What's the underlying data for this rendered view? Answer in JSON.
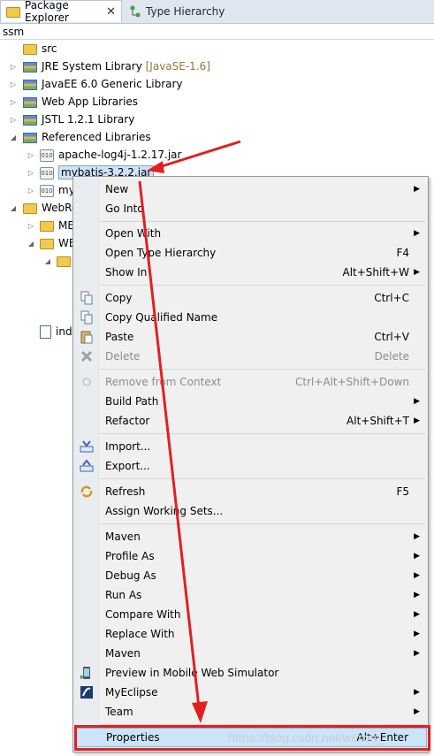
{
  "tabs": [
    {
      "label": "Package Explorer",
      "close": "✕"
    },
    {
      "label": "Type Hierarchy"
    }
  ],
  "breadcrumb": "ssm",
  "tree": [
    {
      "label": "src",
      "suffix": ""
    },
    {
      "label": "JRE System Library",
      "suffix": "[JavaSE-1.6]"
    },
    {
      "label": "JavaEE 6.0 Generic Library",
      "suffix": ""
    },
    {
      "label": "Web App Libraries",
      "suffix": ""
    },
    {
      "label": "JSTL 1.2.1 Library",
      "suffix": ""
    },
    {
      "label": "Referenced Libraries",
      "suffix": ""
    },
    {
      "label": "apache-log4j-1.2.17.jar",
      "suffix": ""
    },
    {
      "label": "mybatis-3.2.2.jar",
      "suffix": ""
    },
    {
      "label": "my",
      "suffix": ""
    },
    {
      "label": "WebRo",
      "suffix": ""
    },
    {
      "label": "ME",
      "suffix": ""
    },
    {
      "label": "WE",
      "suffix": ""
    },
    {
      "label": "",
      "suffix": ""
    },
    {
      "label": "ind",
      "suffix": ""
    }
  ],
  "menu": [
    {
      "label": "New",
      "accel": "",
      "submenu": true
    },
    {
      "label": "Go Into",
      "accel": ""
    },
    {
      "label": "Open With",
      "accel": "",
      "submenu": true
    },
    {
      "label": "Open Type Hierarchy",
      "accel": "F4"
    },
    {
      "label": "Show In",
      "accel": "Alt+Shift+W",
      "submenu": true
    },
    {
      "label": "Copy",
      "accel": "Ctrl+C"
    },
    {
      "label": "Copy Qualified Name",
      "accel": ""
    },
    {
      "label": "Paste",
      "accel": "Ctrl+V"
    },
    {
      "label": "Delete",
      "accel": "Delete",
      "disabled": true
    },
    {
      "label": "Remove from Context",
      "accel": "Ctrl+Alt+Shift+Down",
      "disabled": true
    },
    {
      "label": "Build Path",
      "accel": "",
      "submenu": true
    },
    {
      "label": "Refactor",
      "accel": "Alt+Shift+T",
      "submenu": true
    },
    {
      "label": "Import...",
      "accel": ""
    },
    {
      "label": "Export...",
      "accel": ""
    },
    {
      "label": "Refresh",
      "accel": "F5"
    },
    {
      "label": "Assign Working Sets...",
      "accel": ""
    },
    {
      "label": "Maven",
      "accel": "",
      "submenu": true
    },
    {
      "label": "Profile As",
      "accel": "",
      "submenu": true
    },
    {
      "label": "Debug As",
      "accel": "",
      "submenu": true
    },
    {
      "label": "Run As",
      "accel": "",
      "submenu": true
    },
    {
      "label": "Compare With",
      "accel": "",
      "submenu": true
    },
    {
      "label": "Replace With",
      "accel": "",
      "submenu": true
    },
    {
      "label": "Maven",
      "accel": "",
      "submenu": true
    },
    {
      "label": "Preview in Mobile Web Simulator",
      "accel": ""
    },
    {
      "label": "MyEclipse",
      "accel": "",
      "submenu": true
    },
    {
      "label": "Team",
      "accel": "",
      "submenu": true
    },
    {
      "label": "Properties",
      "accel": "Alt+Enter"
    }
  ],
  "watermark": "https://blog.csdn.net/weixin_",
  "colors": {
    "annotation": "#e02020",
    "highlight": "#cce4f7"
  }
}
